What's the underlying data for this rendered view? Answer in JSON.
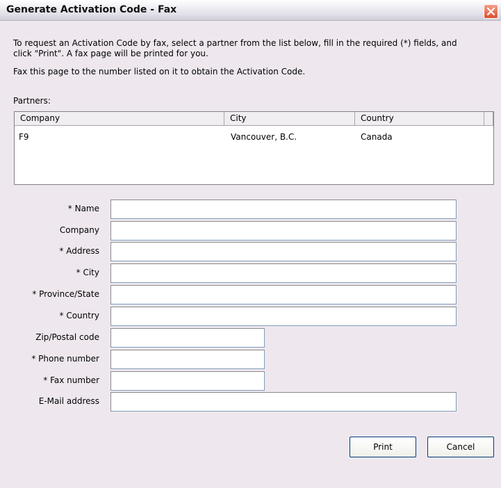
{
  "window": {
    "title": "Generate Activation Code - Fax",
    "close_icon": "close-icon"
  },
  "instructions": {
    "line1": "To request an Activation Code by fax, select a partner from the list below, fill in the required (*) fields, and",
    "line2": "click \"Print\". A fax page will be printed for you.",
    "line3": "Fax this page to the number listed on it to obtain the Activation Code."
  },
  "partners": {
    "label": "Partners:",
    "columns": [
      "Company",
      "City",
      "Country"
    ],
    "rows": [
      {
        "company": "F9",
        "city": "Vancouver, B.C.",
        "country": "Canada"
      }
    ]
  },
  "form": {
    "name": {
      "label": "* Name",
      "value": ""
    },
    "company": {
      "label": "Company",
      "value": ""
    },
    "address": {
      "label": "* Address",
      "value": ""
    },
    "city": {
      "label": "* City",
      "value": ""
    },
    "province": {
      "label": "* Province/State",
      "value": ""
    },
    "country": {
      "label": "* Country",
      "value": ""
    },
    "zip": {
      "label": "Zip/Postal code",
      "value": ""
    },
    "phone": {
      "label": "* Phone number",
      "value": ""
    },
    "fax": {
      "label": "* Fax number",
      "value": ""
    },
    "email": {
      "label": "E-Mail address",
      "value": ""
    }
  },
  "buttons": {
    "print": "Print",
    "cancel": "Cancel"
  }
}
